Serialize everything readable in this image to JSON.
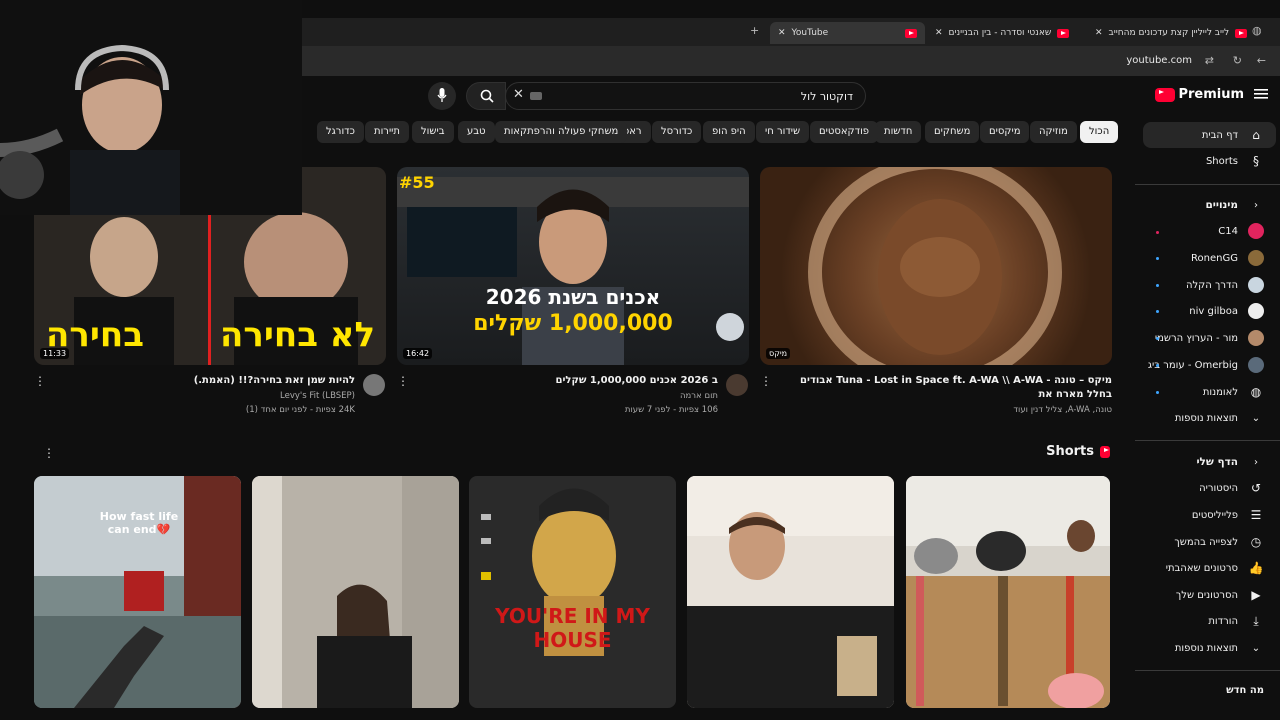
{
  "browser": {
    "tabs": [
      {
        "title": "YouTube"
      },
      {
        "title": "שאנטי וסדרה - בין הבניינים"
      },
      {
        "title": "לייב לייליין קצת עדכונים מהחייב"
      }
    ],
    "url": "youtube.com"
  },
  "header": {
    "brand": "Premium",
    "search_query": "דוקטור לול"
  },
  "chips": [
    "הכול",
    "מוזיקה",
    "מיקסים",
    "משחקים",
    "חדשות",
    "פודקאסטים",
    "שידור חי",
    "היפ הופ",
    "כדורסל",
    "ראפ",
    "משחקי פעולה והרפתקאות",
    "טבע",
    "בישול",
    "תיירות",
    "כדורגל"
  ],
  "sidebar": {
    "home": "דף הבית",
    "shorts": "Shorts",
    "subs_title": "מינויים",
    "subscriptions": [
      "C14",
      "RonenGG",
      "הדרך הקלה",
      "niv gilboa",
      "מור - הערוץ הרשמי",
      "Omerbig - עומר ביג",
      "לאומנות"
    ],
    "more1": "תוצאות נוספות",
    "you_title": "הדף שלי",
    "you_items": [
      "היסטוריה",
      "פלייליסטים",
      "לצפייה בהמשך",
      "סרטונים שאהבתי",
      "הסרטונים שלך",
      "הורדות",
      "תוצאות נוספות"
    ],
    "whats_new": "מה חדש"
  },
  "videos": [
    {
      "title": "מיקס – טונה - Tuna - Lost in Space ft. A-WA \\\\ A-WA אבודים בחלל מארח את",
      "channel": "טונה, A-WA, צליל דנין ועוד",
      "stats": "",
      "duration": "מיקס",
      "overlay": ""
    },
    {
      "title": "ב 2026 אכנים 1,000,000 שקלים",
      "channel": "תום ארמה",
      "stats": "106 צפיות - לפני 7 שעות",
      "duration": "16:42",
      "overlay": "#55"
    },
    {
      "title": "להיות שמן זאת בחירה?!! (האמת.)",
      "channel": "Levy's Fit (LBSEP)",
      "stats": "24K צפיות - לפני יום אחד (1)",
      "duration": "11:33",
      "overlay": ""
    }
  ],
  "thumb_text": {
    "v2_line1": "אכנים בשנת 2026",
    "v2_line2": "1,000,000 שקלים",
    "v3_left": "לא בחירה",
    "v3_right": "בחירה"
  },
  "shorts_title": "Shorts",
  "shorts": [
    {
      "caption": ""
    },
    {
      "caption": ""
    },
    {
      "caption": "YOU'RE IN MY HOUSE"
    },
    {
      "caption": ""
    },
    {
      "caption": "How fast life can end💔"
    }
  ]
}
